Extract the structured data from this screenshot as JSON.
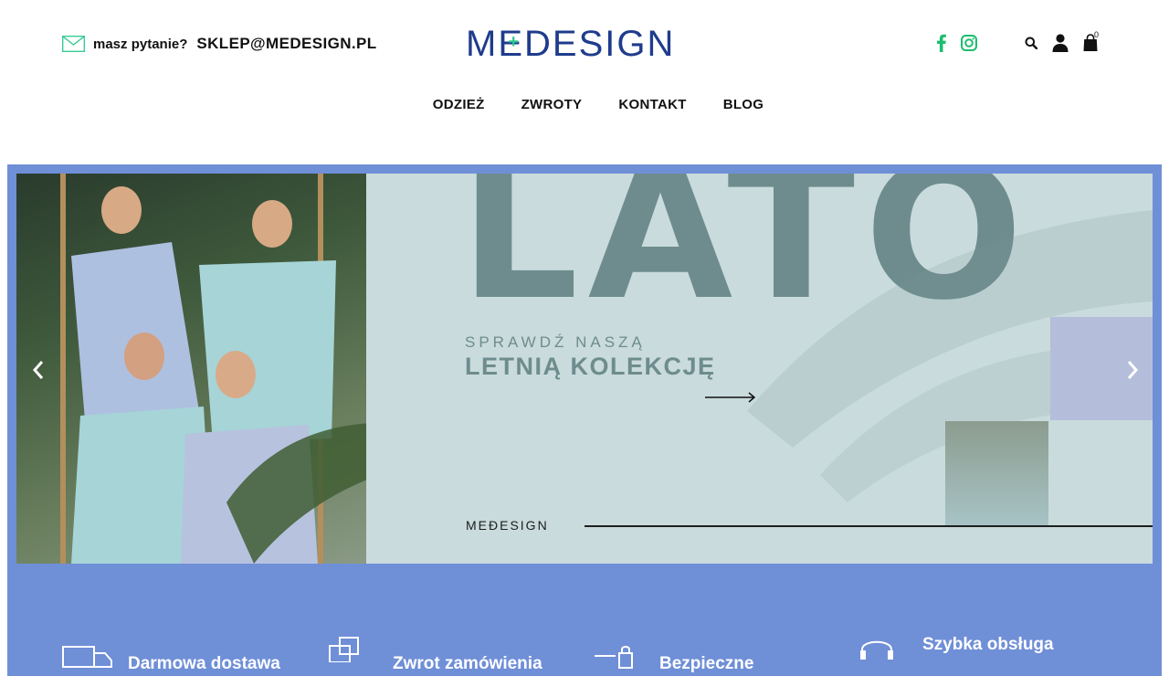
{
  "header": {
    "ask_label": "masz pytanie?",
    "email": "SKLEP@MEDESIGN.PL",
    "logo": {
      "prefix": "M",
      "e": "E",
      "suffix": "DESIGN"
    }
  },
  "icons": {
    "mail": "mail-icon",
    "facebook": "facebook-icon",
    "instagram": "instagram-icon",
    "search": "search-icon",
    "account": "user-icon",
    "cart": "shopping-bag-icon"
  },
  "cart": {
    "count": "0"
  },
  "nav": {
    "items": [
      {
        "label": "ODZIEŻ"
      },
      {
        "label": "ZWROTY"
      },
      {
        "label": "KONTAKT"
      },
      {
        "label": "BLOG"
      }
    ]
  },
  "banner": {
    "headline": "LATO",
    "subline_small": "SPRAWDŹ NASZĄ",
    "subline_big": "LETNIĄ KOLEKCJĘ",
    "brand_small": "MEĐESIGN"
  },
  "features": [
    {
      "label": "Darmowa dostawa",
      "icon": "truck-icon"
    },
    {
      "label": "Zwrot zamówienia",
      "icon": "box-return-icon"
    },
    {
      "label": "Bezpieczne",
      "icon": "lock-icon"
    },
    {
      "label": "Szybka obsługa",
      "icon": "headset-icon"
    }
  ],
  "colors": {
    "logo_blue": "#1f3c8c",
    "logo_green": "#2cc98e",
    "social_green": "#1ebd6e",
    "hero_bg": "#6f8fd7",
    "banner_bg": "#c9dbdc",
    "banner_text": "#6e8c8e"
  }
}
